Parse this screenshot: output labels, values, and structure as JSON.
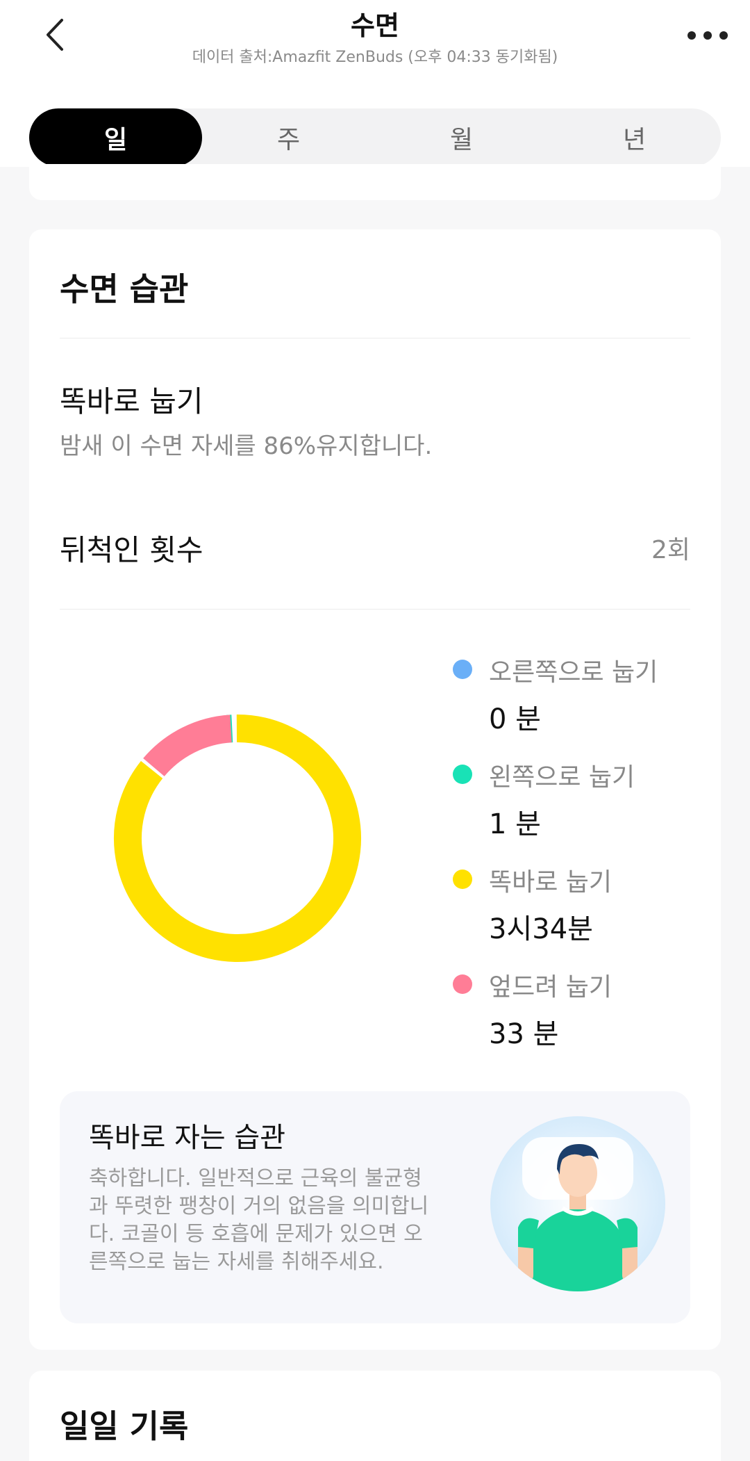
{
  "header": {
    "title": "수면",
    "subtitle": "데이터 출처:Amazfit ZenBuds (오후 04:33 동기화됨)",
    "back_icon": "chevron-left-icon",
    "more_icon": "more-horizontal-icon"
  },
  "tabs": [
    {
      "label": "일",
      "active": true
    },
    {
      "label": "주",
      "active": false
    },
    {
      "label": "월",
      "active": false
    },
    {
      "label": "년",
      "active": false
    }
  ],
  "habit_card": {
    "title": "수면 습관",
    "posture_title": "똑바로 눕기",
    "posture_desc": "밤새 이 수면 자세를 86%유지합니다.",
    "turns_label": "뒤척인 횟수",
    "turns_value": "2회",
    "legend": [
      {
        "label": "오른쪽으로 눕기",
        "value": "0 분",
        "color": "#6aaff7"
      },
      {
        "label": "왼쪽으로 눕기",
        "value": "1 분",
        "color": "#19e2b6"
      },
      {
        "label": "똑바로 눕기",
        "value": "3시34분",
        "color": "#ffe100"
      },
      {
        "label": "엎드려 눕기",
        "value": "33 분",
        "color": "#ff7d96"
      }
    ],
    "tip": {
      "title": "똑바로 자는 습관",
      "body": "축하합니다. 일반적으로 근육의 불균형과 뚜렷한 팽창이 거의 없음을 의미합니다. 코골이 등 호흡에 문제가 있으면 오른쪽으로 눕는 자세를 취해주세요.",
      "illustration": "sleeping-person-illustration"
    }
  },
  "daily_record": {
    "title": "일일 기록"
  },
  "chart_data": {
    "type": "pie",
    "series": [
      {
        "name": "오른쪽으로 눕기",
        "value": 0,
        "color": "#6aaff7"
      },
      {
        "name": "왼쪽으로 눕기",
        "value": 1,
        "color": "#19e2b6"
      },
      {
        "name": "똑바로 눕기",
        "value": 214,
        "color": "#ffe100"
      },
      {
        "name": "엎드려 눕기",
        "value": 33,
        "color": "#ff7d96"
      }
    ]
  }
}
